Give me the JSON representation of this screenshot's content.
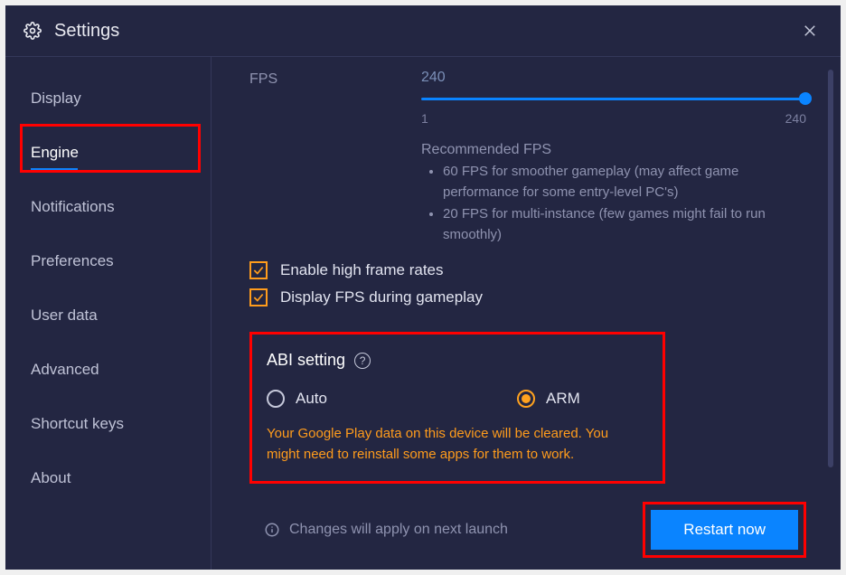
{
  "header": {
    "title": "Settings"
  },
  "sidebar": {
    "items": [
      {
        "label": "Display"
      },
      {
        "label": "Engine"
      },
      {
        "label": "Notifications"
      },
      {
        "label": "Preferences"
      },
      {
        "label": "User data"
      },
      {
        "label": "Advanced"
      },
      {
        "label": "Shortcut keys"
      },
      {
        "label": "About"
      }
    ],
    "active_index": 1
  },
  "fps": {
    "label": "FPS",
    "value": "240",
    "min_label": "1",
    "max_label": "240",
    "recommended_title": "Recommended FPS",
    "recommended": [
      "60 FPS for smoother gameplay (may affect game performance for some entry-level PC's)",
      "20 FPS for multi-instance (few games might fail to run smoothly)"
    ]
  },
  "checks": {
    "high_frame": {
      "label": "Enable high frame rates",
      "checked": true
    },
    "display_fps": {
      "label": "Display FPS during gameplay",
      "checked": true
    }
  },
  "abi": {
    "title": "ABI setting",
    "options": [
      {
        "label": "Auto",
        "selected": false
      },
      {
        "label": "ARM",
        "selected": true
      }
    ],
    "warning": "Your Google Play data on this device will be cleared. You might need to reinstall some apps for them to work."
  },
  "footer": {
    "note": "Changes will apply on next launch",
    "restart_label": "Restart now"
  }
}
